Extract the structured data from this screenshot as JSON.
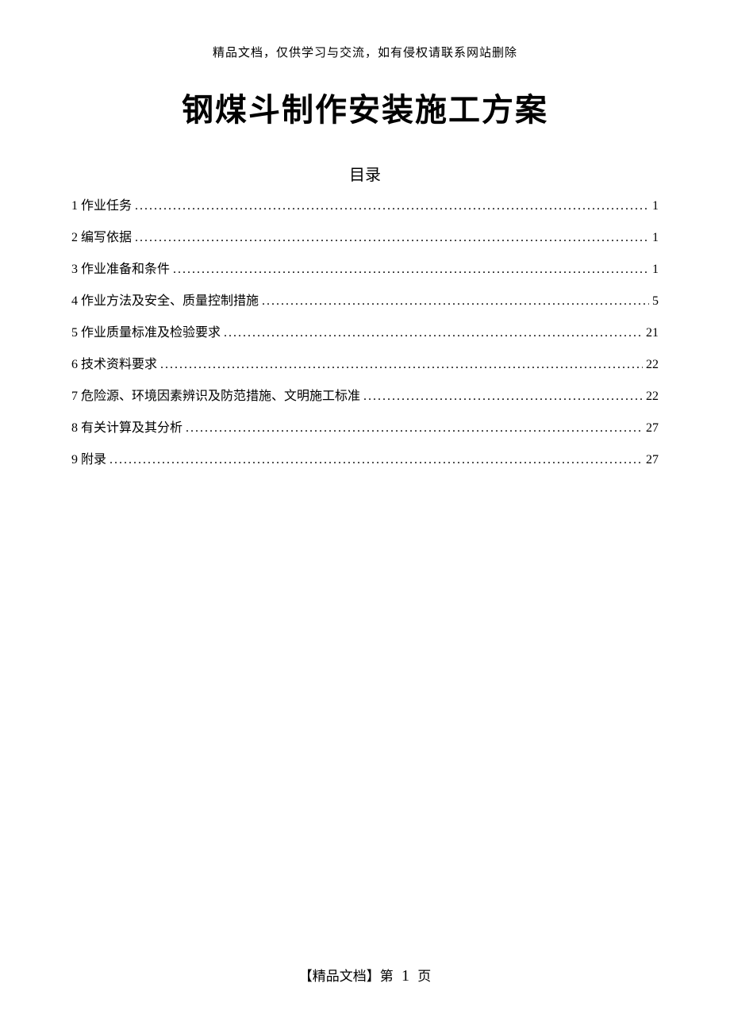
{
  "header": {
    "notice": "精品文档，仅供学习与交流，如有侵权请联系网站删除"
  },
  "title": "钢煤斗制作安装施工方案",
  "toc": {
    "heading": "目录",
    "items": [
      {
        "label": "1 作业任务",
        "page": "1"
      },
      {
        "label": "2 编写依据",
        "page": "1"
      },
      {
        "label": "3 作业准备和条件",
        "page": "1"
      },
      {
        "label": "4 作业方法及安全、质量控制措施",
        "page": "5"
      },
      {
        "label": "5 作业质量标准及检验要求",
        "page": "21"
      },
      {
        "label": "6 技术资料要求",
        "page": "22"
      },
      {
        "label": "7 危险源、环境因素辨识及防范措施、文明施工标准",
        "page": "22"
      },
      {
        "label": "8 有关计算及其分析",
        "page": "27"
      },
      {
        "label": "9 附录",
        "page": "27"
      }
    ]
  },
  "footer": {
    "prefix": "【精品文档】第",
    "page_num": "1",
    "suffix": "页"
  }
}
